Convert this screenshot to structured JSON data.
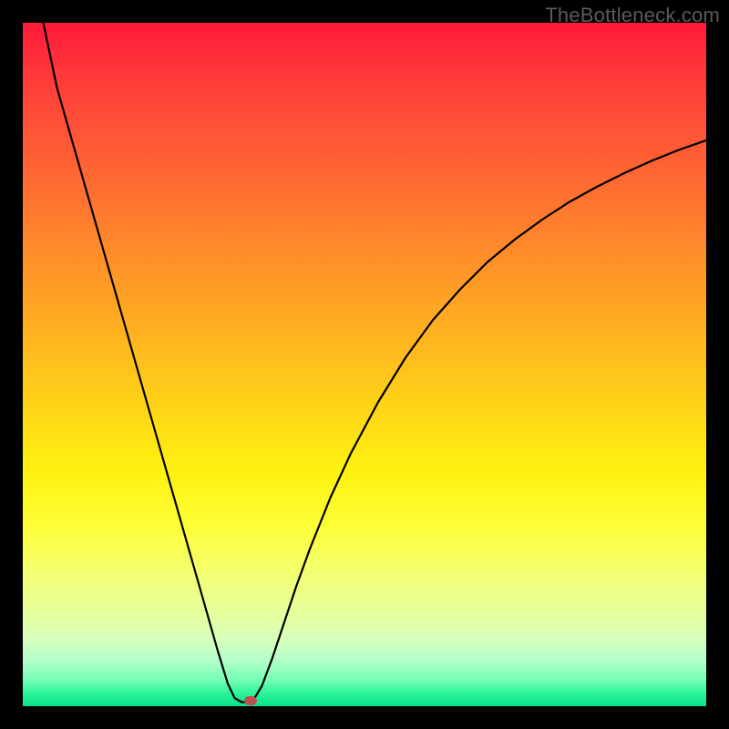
{
  "watermark": "TheBottleneck.com",
  "chart_data": {
    "type": "line",
    "title": "",
    "xlabel": "",
    "ylabel": "",
    "xlim": [
      0,
      100
    ],
    "ylim": [
      0,
      100
    ],
    "grid": false,
    "legend": false,
    "background_gradient": {
      "top": "#ff1a3a",
      "bottom": "#06e08a",
      "description": "vertical red-orange-yellow-green gradient"
    },
    "series": [
      {
        "name": "curve",
        "color": "#000000",
        "x": [
          3.0,
          5,
          8,
          11,
          14,
          17,
          20,
          23,
          26,
          28.5,
          30,
          31,
          32,
          33,
          33.8,
          35,
          36.5,
          38,
          40,
          42,
          45,
          48,
          52,
          56,
          60,
          64,
          68,
          72,
          76,
          80,
          84,
          88,
          92,
          96,
          100
        ],
        "y": [
          100,
          90.5,
          80,
          69.5,
          59,
          48.5,
          38,
          27.5,
          17,
          8.2,
          3.3,
          1.2,
          0.6,
          0.6,
          1.0,
          3.0,
          7.0,
          11.5,
          17.5,
          23,
          30.5,
          37,
          44.5,
          51,
          56.5,
          61,
          65,
          68.3,
          71.2,
          73.8,
          76,
          78,
          79.8,
          81.4,
          82.8
        ]
      }
    ],
    "marker": {
      "x": 33.3,
      "y": 0.8,
      "color": "#c05050"
    }
  }
}
